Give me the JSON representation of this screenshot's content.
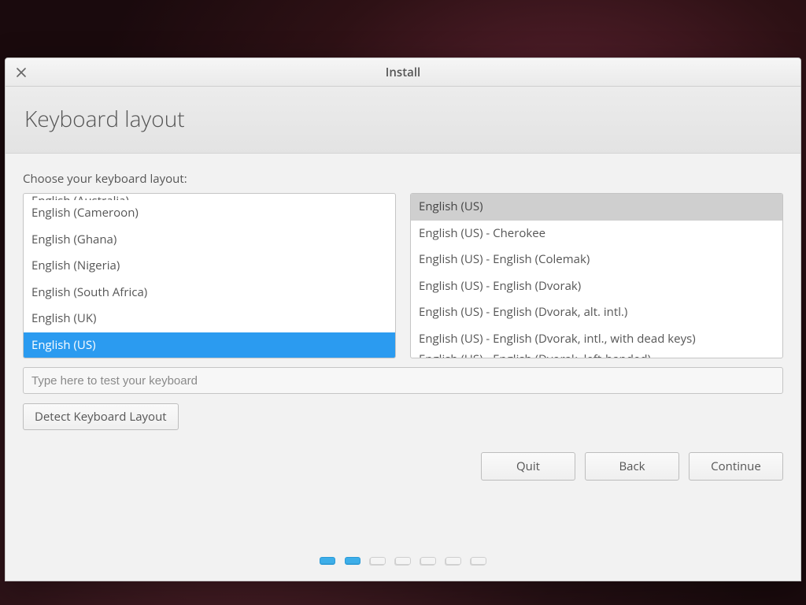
{
  "window": {
    "title": "Install",
    "heading": "Keyboard layout"
  },
  "prompt": "Choose your keyboard layout:",
  "layouts": {
    "peek_top": "English (Australia)",
    "items": [
      "English (Cameroon)",
      "English (Ghana)",
      "English (Nigeria)",
      "English (South Africa)",
      "English (UK)",
      "English (US)"
    ],
    "selected_index": 5
  },
  "variants": {
    "items": [
      "English (US)",
      "English (US) - Cherokee",
      "English (US) - English (Colemak)",
      "English (US) - English (Dvorak)",
      "English (US) - English (Dvorak, alt. intl.)",
      "English (US) - English (Dvorak, intl., with dead keys)"
    ],
    "peek_bottom": "English (US) - English (Dvorak, left-handed)",
    "selected_index": 0
  },
  "test_placeholder": "Type here to test your keyboard",
  "buttons": {
    "detect": "Detect Keyboard Layout",
    "quit": "Quit",
    "back": "Back",
    "continue": "Continue"
  },
  "pager": {
    "total": 7,
    "current": 2
  }
}
